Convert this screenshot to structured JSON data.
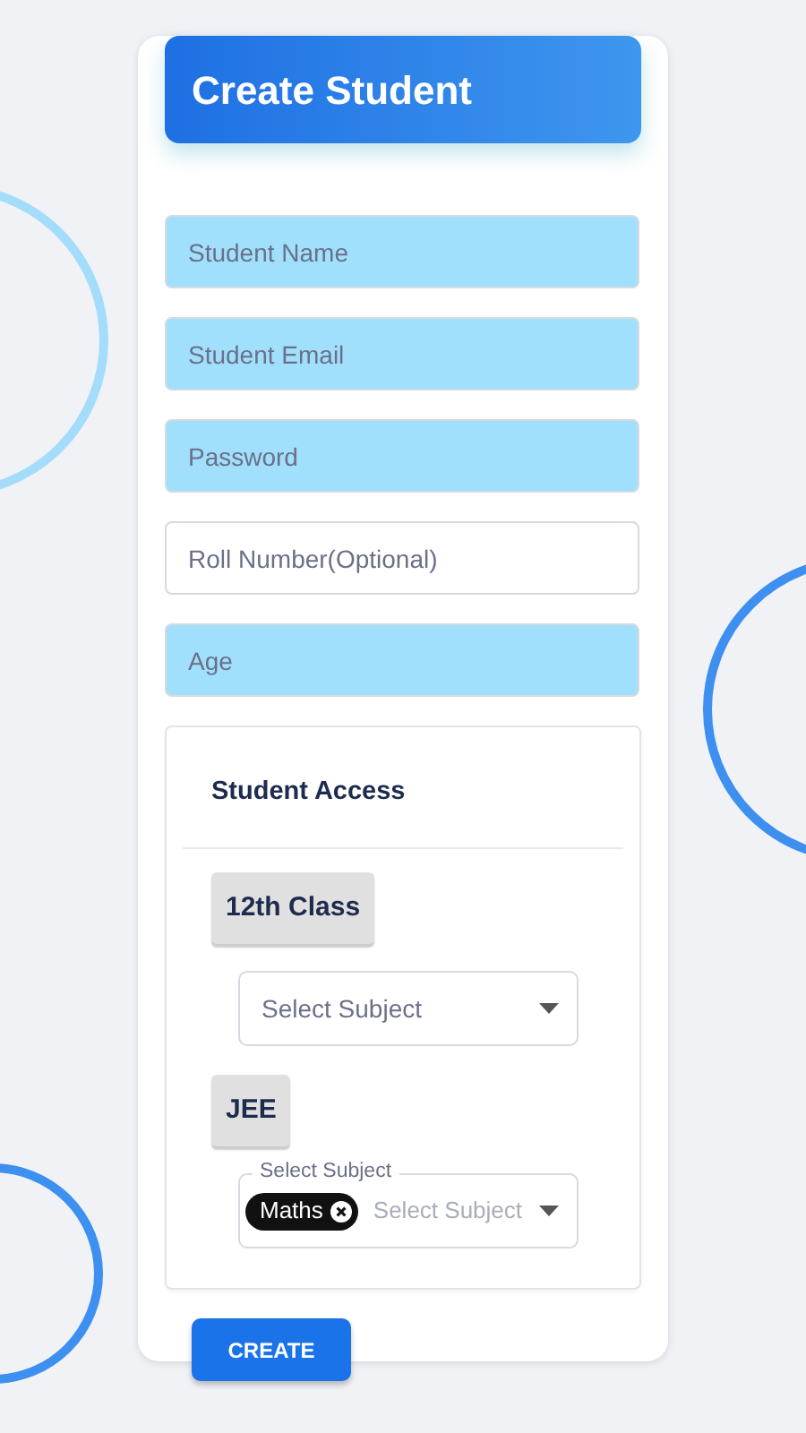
{
  "header": {
    "title": "Create Student"
  },
  "fields": [
    {
      "placeholder": "Student Name",
      "highlighted": true
    },
    {
      "placeholder": "Student Email",
      "highlighted": true
    },
    {
      "placeholder": "Password",
      "highlighted": true
    },
    {
      "placeholder": "Roll Number(Optional)",
      "highlighted": false
    },
    {
      "placeholder": "Age",
      "highlighted": true
    }
  ],
  "access": {
    "title": "Student Access",
    "groups": [
      {
        "label": "12th Class",
        "select": {
          "placeholder": "Select Subject"
        }
      },
      {
        "label": "JEE",
        "select": {
          "placeholder": "Select Subject",
          "floating_label": "Select Subject",
          "chips": [
            "Maths"
          ]
        }
      }
    ]
  },
  "submit": "CREATE"
}
